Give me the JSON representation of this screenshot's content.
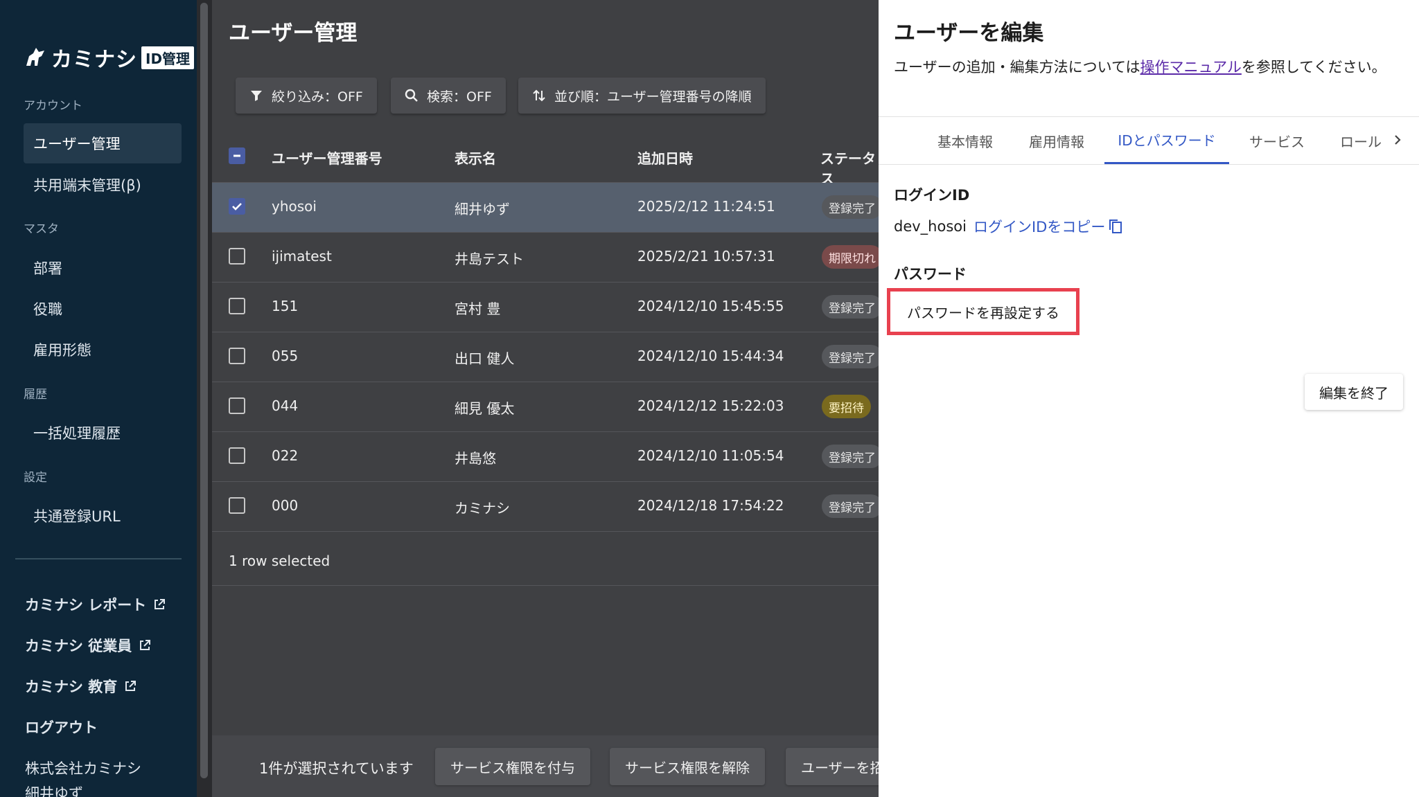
{
  "sidebar": {
    "logo_text": "カミナシ",
    "logo_badge": "ID管理",
    "sections": {
      "account": "アカウント",
      "master": "マスタ",
      "history": "履歴",
      "settings": "設定"
    },
    "items": {
      "user_management": "ユーザー管理",
      "shared_device": "共用端末管理(β)",
      "department": "部署",
      "position": "役職",
      "employment_type": "雇用形態",
      "batch_history": "一括処理履歴",
      "common_url": "共通登録URL"
    },
    "external": {
      "report": "カミナシ レポート",
      "employee": "カミナシ 従業員",
      "education": "カミナシ 教育"
    },
    "logout": "ログアウト",
    "company": "株式会社カミナシ",
    "user": "細井ゆず"
  },
  "main": {
    "title": "ユーザー管理",
    "toolbar": {
      "filter": "絞り込み：OFF",
      "search": "検索：OFF",
      "sort": "並び順：ユーザー管理番号の降順"
    },
    "columns": {
      "id": "ユーザー管理番号",
      "name": "表示名",
      "added": "追加日時",
      "status": "ステータス"
    },
    "rows": [
      {
        "id": "yhosoi",
        "name": "細井ゆず",
        "added": "2025/2/12 11:24:51",
        "status": "登録完了",
        "kind": "done",
        "selected": true
      },
      {
        "id": "ijimatest",
        "name": "井島テスト",
        "added": "2025/2/21 10:57:31",
        "status": "期限切れ",
        "kind": "expired",
        "selected": false
      },
      {
        "id": "151",
        "name": "宮村 豊",
        "added": "2024/12/10 15:45:55",
        "status": "登録完了",
        "kind": "done",
        "selected": false
      },
      {
        "id": "055",
        "name": "出口 健人",
        "added": "2024/12/10 15:44:34",
        "status": "登録完了",
        "kind": "done",
        "selected": false
      },
      {
        "id": "044",
        "name": "細見 優太",
        "added": "2024/12/12 15:22:03",
        "status": "要招待",
        "kind": "invite",
        "selected": false
      },
      {
        "id": "022",
        "name": "井島悠",
        "added": "2024/12/10 11:05:54",
        "status": "登録完了",
        "kind": "done",
        "selected": false
      },
      {
        "id": "000",
        "name": "カミナシ",
        "added": "2024/12/18 17:54:22",
        "status": "登録完了",
        "kind": "done",
        "selected": false
      }
    ],
    "row_selected_text": "1 row selected",
    "bottom_bar": {
      "count": "1件が選択されています",
      "grant": "サービス権限を付与",
      "revoke": "サービス権限を解除",
      "invite": "ユーザーを招待"
    }
  },
  "drawer": {
    "title": "ユーザーを編集",
    "desc_before": "ユーザーの追加・編集方法については",
    "desc_link": "操作マニュアル",
    "desc_after": "を参照してください。",
    "tabs": [
      "基本情報",
      "雇用情報",
      "IDとパスワード",
      "サービス",
      "ロール"
    ],
    "login_id_label": "ログインID",
    "login_id_value": "dev_hosoi",
    "copy_label": "ログインIDをコピー",
    "password_label": "パスワード",
    "reset_button": "パスワードを再設定する",
    "finish_button": "編集を終了"
  },
  "colors": {
    "sidebar_bg": "#0e2638",
    "accent": "#3257c5",
    "highlight": "#e8414f"
  }
}
